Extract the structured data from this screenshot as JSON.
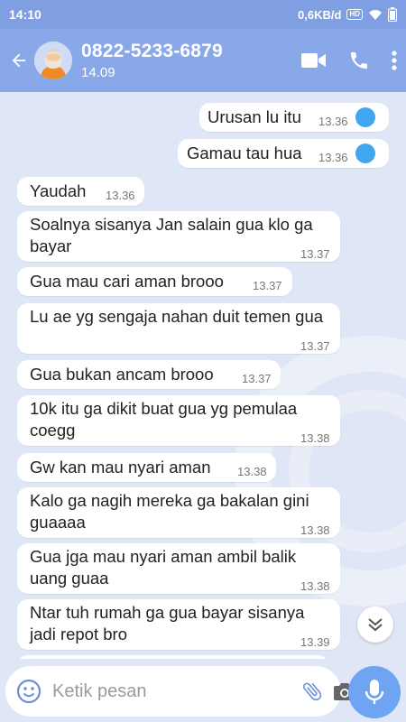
{
  "status_bar": {
    "time": "14:10",
    "net_speed": "0,6KB/d",
    "hd_badge": "HD"
  },
  "contact": {
    "name": "0822-5233-6879",
    "status": "14.09"
  },
  "icons": {
    "back": "back-arrow-icon",
    "video": "video-camera-icon",
    "phone": "phone-icon",
    "more": "more-vert-icon",
    "emoji": "emoji-icon",
    "attach": "paperclip-icon",
    "camera": "camera-icon",
    "mic": "microphone-icon",
    "scroll": "chevron-double-down-icon"
  },
  "colors": {
    "header": "#88a8ea",
    "statusbar": "#7f9fe2",
    "chat_bg": "#dfe6f5",
    "read_tick": "#3fa6f0",
    "mic": "#6ea4f2"
  },
  "messages": [
    {
      "dir": "out",
      "text": "Urusan lu itu",
      "time": "13.36"
    },
    {
      "dir": "out",
      "text": "Gamau tau hua",
      "time": "13.36"
    },
    {
      "dir": "in",
      "text": "Yaudah",
      "time": "13.36"
    },
    {
      "dir": "in",
      "text": "Soalnya sisanya Jan salain gua klo ga bayar",
      "time": "13.37"
    },
    {
      "dir": "in",
      "text": "Gua mau cari aman brooo",
      "time": "13.37"
    },
    {
      "dir": "in",
      "text": "Lu ae yg sengaja nahan duit temen gua",
      "time": "13.37"
    },
    {
      "dir": "in",
      "text": "Gua bukan ancam brooo",
      "time": "13.37"
    },
    {
      "dir": "in",
      "text": "10k itu ga dikit buat gua yg pemulaa coegg",
      "time": "13.38"
    },
    {
      "dir": "in",
      "text": "Gw kan mau nyari aman",
      "time": "13.38"
    },
    {
      "dir": "in",
      "text": "Kalo ga nagih mereka ga bakalan gini guaaaa",
      "time": "13.38"
    },
    {
      "dir": "in",
      "text": "Gua jga mau nyari aman ambil balik uang guaa",
      "time": "13.38"
    },
    {
      "dir": "in",
      "text": "Ntar tuh rumah ga gua bayar sisanya jadi repot bro",
      "time": "13.39"
    }
  ],
  "composer": {
    "placeholder": "Ketik pesan"
  }
}
